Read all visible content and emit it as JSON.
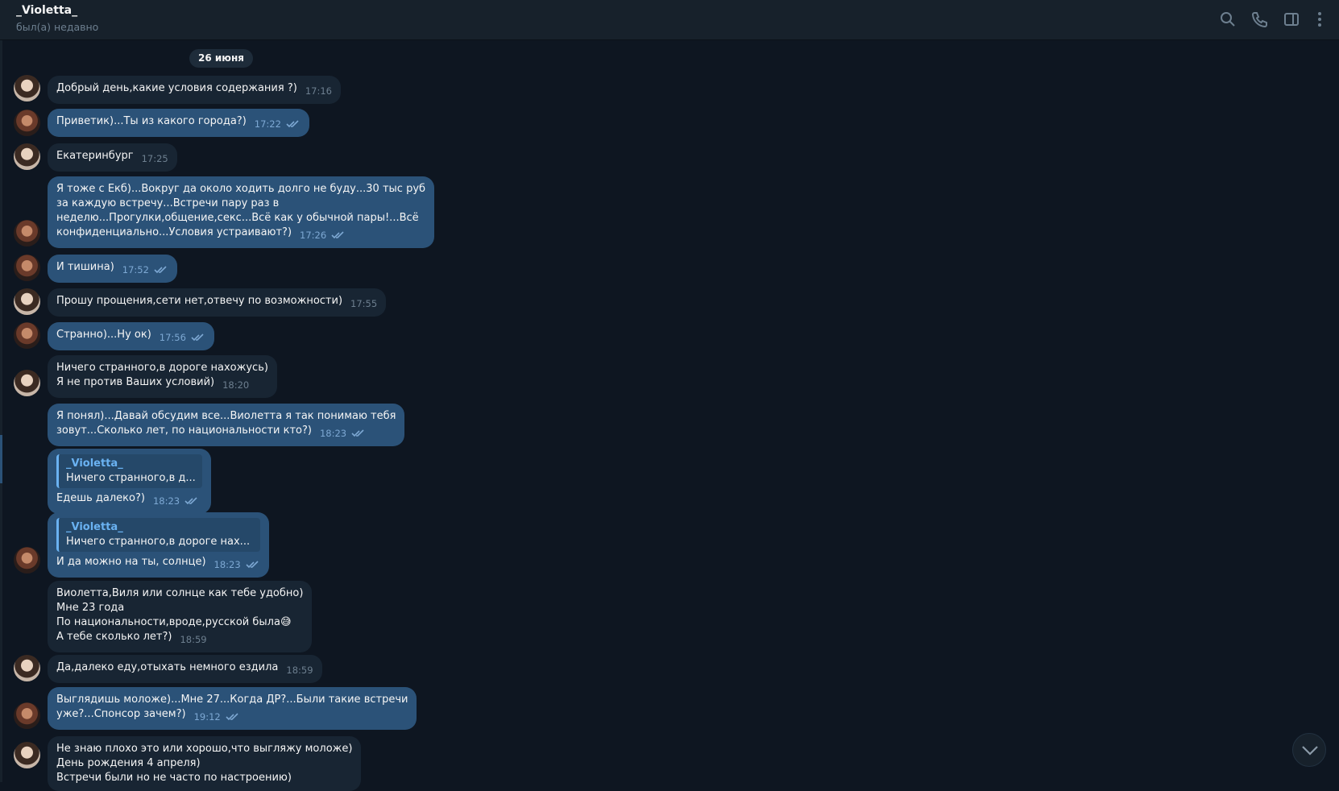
{
  "header": {
    "title": "_Violetta_",
    "status": "был(а) недавно"
  },
  "date_separator": "26 июня",
  "messages": [
    {
      "dir": "in",
      "text": "Добрый день,какие условия содержания ?)",
      "time": "17:16"
    },
    {
      "dir": "out",
      "text": "Приветик)...Ты из какого города?)",
      "time": "17:22"
    },
    {
      "dir": "in",
      "text": "Екатеринбург",
      "time": "17:25"
    },
    {
      "dir": "out",
      "text": "Я тоже с Екб)...Вокруг да около ходить долго не буду...30 тыс руб\nза каждую встречу...Встречи пару раз в\nнеделю...Прогулки,общение,секс...Всё как у обычной пары!...Всё\nконфиденциально...Условия устраивают?)",
      "time": "17:26"
    },
    {
      "dir": "out",
      "text": "И тишина)",
      "time": "17:52"
    },
    {
      "dir": "in",
      "text": "Прошу прощения,сети нет,отвечу по возможности)",
      "time": "17:55"
    },
    {
      "dir": "out",
      "text": "Странно)...Ну ок)",
      "time": "17:56"
    },
    {
      "dir": "in",
      "text": "Ничего странного,в дороге нахожусь)\nЯ не против Ваших условий)",
      "time": "18:20"
    },
    {
      "dir": "out",
      "text": "Я понял)...Давай обсудим все...Виолетта я так понимаю тебя\nзовут...Сколько лет, по национальности кто?)",
      "time": "18:23"
    },
    {
      "dir": "out",
      "reply_name": "_Violetta_",
      "reply_text": "Ничего странного,в д...",
      "text": "Едешь далеко?)",
      "time": "18:23"
    },
    {
      "dir": "out",
      "reply_name": "_Violetta_",
      "reply_text": "Ничего странного,в дороге нах...",
      "text": "И да можно на ты, солнце)",
      "time": "18:23"
    },
    {
      "dir": "in",
      "text": "Виолетта,Виля или солнце как тебе удобно)\nМне 23 года\nПо национальности,вроде,русской была😅\nА тебе сколько лет?)",
      "time": "18:59"
    },
    {
      "dir": "in",
      "text": "Да,далеко еду,отыхать немного ездила",
      "time": "18:59"
    },
    {
      "dir": "out",
      "text": "Выглядишь моложе)...Мне 27...Когда ДР?...Были такие встречи\nуже?...Спонсор зачем?)",
      "time": "19:12"
    },
    {
      "dir": "in",
      "text": "Не знаю плохо это или хорошо,что выгляжу моложе)\nДень рождения 4 апреля)\nВстречи были но не часто по настроению)",
      "time": ""
    }
  ],
  "colors": {
    "background": "#0e1621",
    "header": "#17212b",
    "incoming": "#182533",
    "outgoing": "#2b5278",
    "accent": "#6ab2f2"
  },
  "icons": [
    "search-icon",
    "phone-icon",
    "sidebar-toggle-icon",
    "more-vertical-icon",
    "chevron-down-icon"
  ]
}
